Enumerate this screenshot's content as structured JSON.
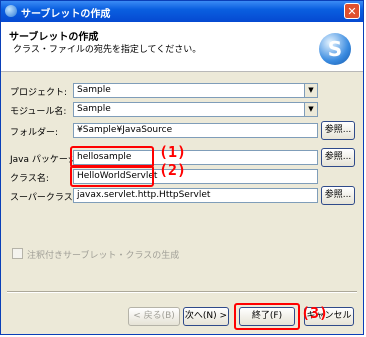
{
  "window": {
    "title": "サーブレットの作成",
    "close_glyph": "✕"
  },
  "header": {
    "title": "サーブレットの作成",
    "description": "クラス・ファイルの宛先を指定してください。",
    "logo_letter": "S"
  },
  "form": {
    "project": {
      "label": "プロジェクト:",
      "value": "Sample"
    },
    "module": {
      "label": "モジュール名:",
      "value": "Sample"
    },
    "folder": {
      "label": "フォルダー:",
      "value": "¥Sample¥JavaSource",
      "browse": "参照..."
    },
    "package": {
      "label": "Java パッケージ:",
      "value": "hellosample",
      "browse": "参照..."
    },
    "class": {
      "label": "クラス名:",
      "value": "HelloWorldServlet"
    },
    "superclass": {
      "label": "スーパークラス:",
      "value": "javax.servlet.http.HttpServlet",
      "browse": "参照..."
    },
    "annotation_checkbox": {
      "label": "注釈付きサーブレット・クラスの生成"
    }
  },
  "buttons": {
    "back": "< 戻る(B)",
    "next": "次へ(N) >",
    "finish": "終了(F)",
    "cancel": "キャンセル"
  },
  "annotations": {
    "a1": "(1)",
    "a2": "(2)",
    "a3": "(3)"
  },
  "colors": {
    "highlight": "#ff0000",
    "title_bar": "#0a5fe0"
  }
}
